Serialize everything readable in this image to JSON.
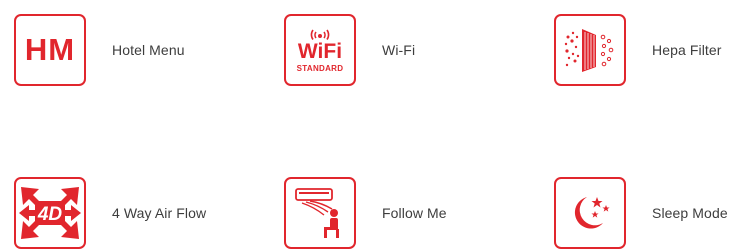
{
  "brand_color": "#e1262d",
  "features": [
    {
      "label": "Hotel Menu",
      "icon": "hotel-menu-icon",
      "icon_text": "HM"
    },
    {
      "label": "Wi-Fi",
      "icon": "wifi-standard-icon",
      "icon_text": "WiFi",
      "icon_subtext": "STANDARD"
    },
    {
      "label": "Hepa Filter",
      "icon": "hepa-filter-icon"
    },
    {
      "label": "4 Way Air Flow",
      "icon": "four-way-airflow-icon",
      "icon_text": "4D"
    },
    {
      "label": "Follow Me",
      "icon": "follow-me-icon"
    },
    {
      "label": "Sleep Mode",
      "icon": "sleep-mode-icon"
    }
  ]
}
